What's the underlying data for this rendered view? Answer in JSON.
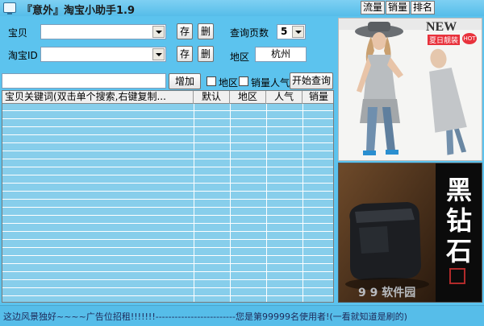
{
  "window": {
    "title": "『意外』淘宝小助手1.9",
    "tabs": [
      "流量",
      "销量",
      "排名"
    ]
  },
  "form": {
    "baobei_label": "宝贝",
    "taobao_id_label": "淘宝ID",
    "save_label": "存",
    "delete_label": "删",
    "pages_label": "查询页数",
    "pages_value": "5",
    "region_label": "地区",
    "region_value": "杭州",
    "add_label": "增加",
    "chk_region_label": "地区",
    "chk_sales_label": "销量人气",
    "search_label": "开始查询"
  },
  "table": {
    "columns": [
      "宝贝关键词(双击单个搜索,右键复制...",
      "默认",
      "地区",
      "人气",
      "销量"
    ]
  },
  "ads": {
    "top_banner_new": "NEW",
    "top_banner_sub": "夏日靓装",
    "top_banner_hot": "HOT",
    "bottom_text": "黑钻石",
    "watermark": "9 9 软件园"
  },
  "status": {
    "text": "这边风景独好~~~~广告位招租!!!!!!!-------------------------您是第99999名使用者!(一看就知道是刷的)"
  },
  "colors": {
    "background": "#5cc3ee",
    "grid": "#87ceeb"
  }
}
